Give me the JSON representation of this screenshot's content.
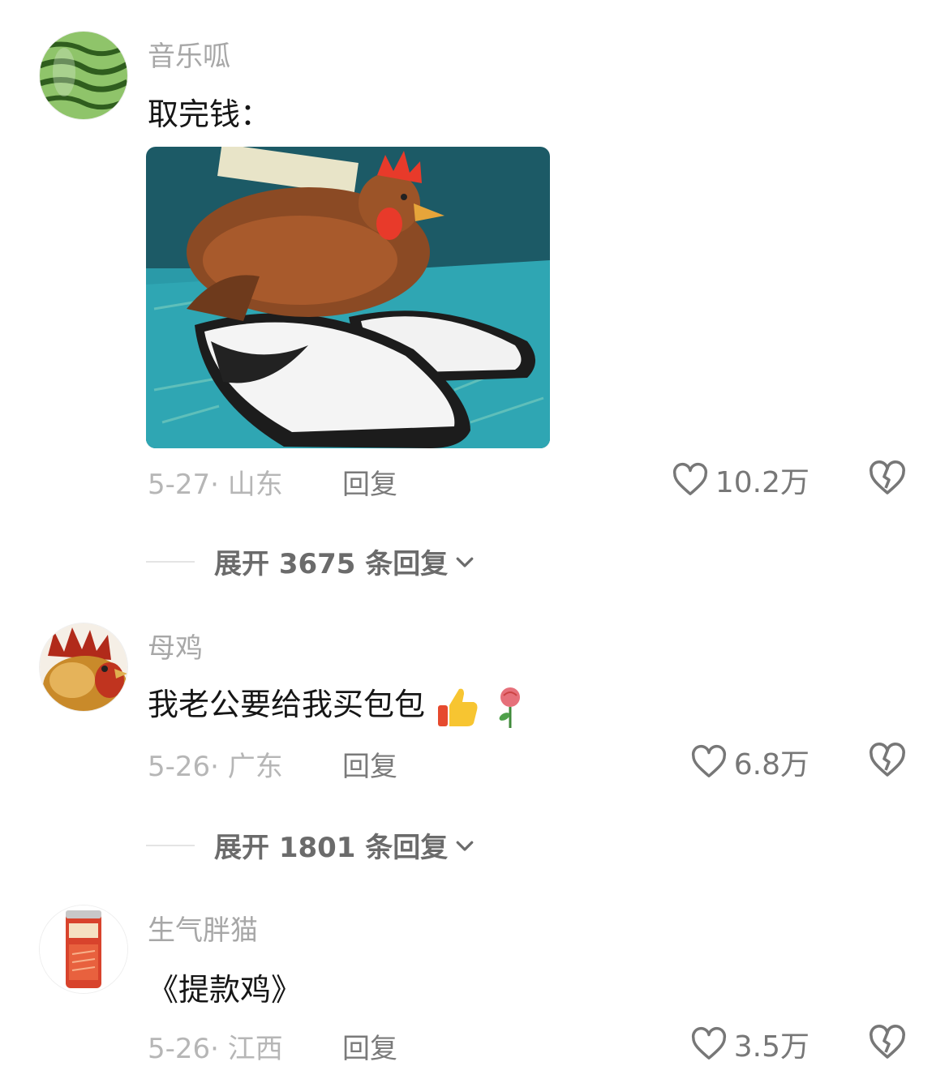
{
  "comments": [
    {
      "username": "音乐呱",
      "text": "取完钱：",
      "date_location": "5-27· 山东",
      "reply_label": "回复",
      "likes": "10.2万",
      "expand_label": "展开 3675 条回复",
      "avatar_icon": "watermelon-avatar"
    },
    {
      "username": "母鸡",
      "text": "我老公要给我买包包",
      "date_location": "5-26· 广东",
      "reply_label": "回复",
      "likes": "6.8万",
      "expand_label": "展开 1801 条回复",
      "avatar_icon": "rooster-avatar"
    },
    {
      "username": "生气胖猫",
      "text": "《提款鸡》",
      "date_location": "5-26· 江西",
      "reply_label": "回复",
      "likes": "3.5万",
      "avatar_icon": "drink-can-avatar"
    }
  ],
  "icons": {
    "like": "heart-outline-icon",
    "dislike": "broken-heart-icon",
    "expand": "chevron-down-icon",
    "emoji_1": "thumbs-up-emoji",
    "emoji_2": "rose-emoji"
  }
}
